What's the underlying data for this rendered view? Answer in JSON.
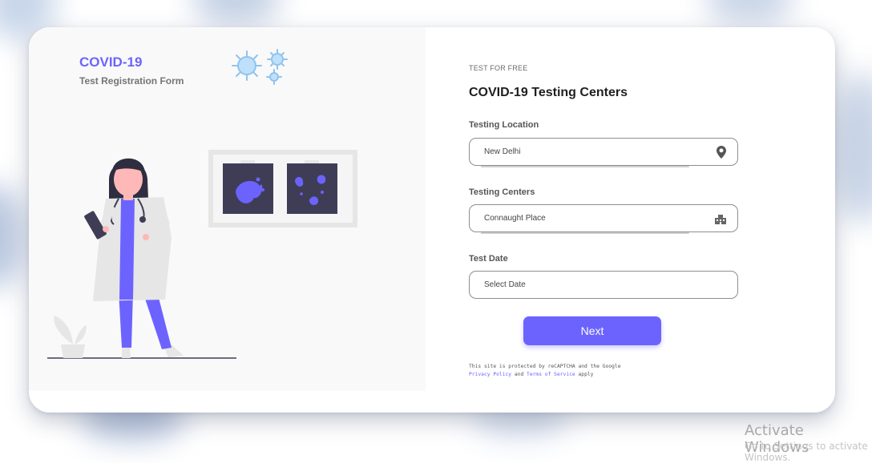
{
  "brand": {
    "title": "COVID-19",
    "subtitle": "Test Registration Form"
  },
  "form": {
    "eyebrow": "TEST FOR FREE",
    "heading": "COVID-19 Testing Centers",
    "location": {
      "label": "Testing Location",
      "value": "New Delhi",
      "icon": "map-pin-icon"
    },
    "centers": {
      "label": "Testing Centers",
      "value": "Connaught Place",
      "icon": "building-icon"
    },
    "date": {
      "label": "Test Date",
      "placeholder": "Select Date"
    },
    "next_label": "Next"
  },
  "legal": {
    "text_before": "This site is protected by reCAPTCHA and the Google",
    "privacy_label": "Privacy Policy",
    "and_text": "and",
    "terms_label": "Terms of Service",
    "apply_text": "apply"
  },
  "watermark": {
    "line1": "Activate Windows",
    "line2": "Go to Settings to activate Windows."
  },
  "colors": {
    "accent": "#6c63ff",
    "virus": "#8fc3f0",
    "panel": "#f9f9f9"
  }
}
